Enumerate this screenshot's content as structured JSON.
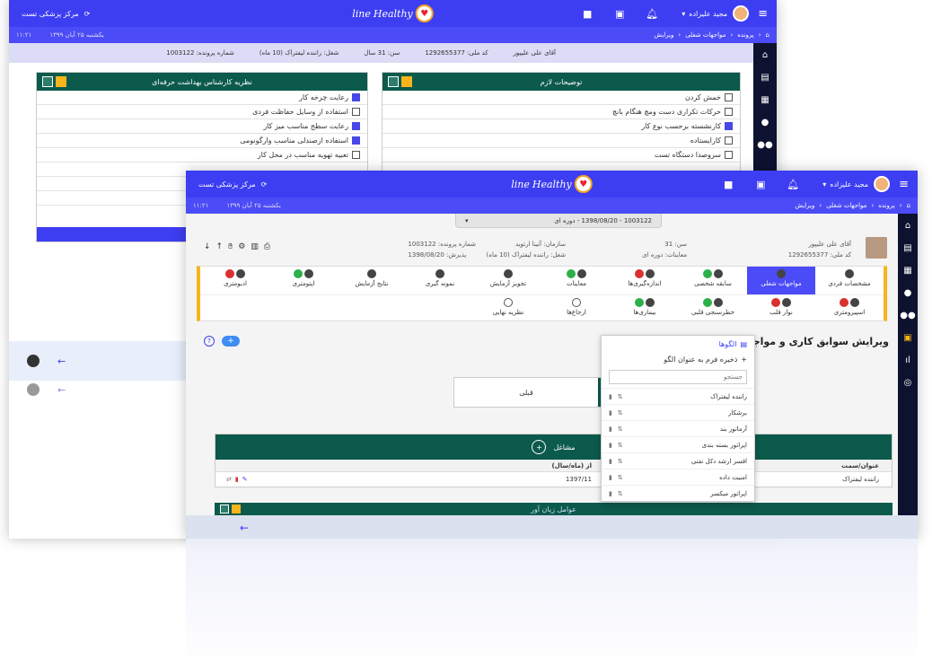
{
  "app": {
    "clinic_name": "مرکز پزشکی تست",
    "user_name": "مجید علیزاده",
    "logo_text": "Healthy",
    "logo_suffix": "line",
    "date_text": "یکشنبه ۲۵ آبان ۱۳۹۹",
    "time_text": "۱۱:۲۱",
    "breadcrumb": [
      "پرونده",
      "مواجهات شغلی",
      "ویرایش"
    ]
  },
  "patient_bar": {
    "name": "آقای علی علیپور",
    "national_code": "کد ملی: 1292655377",
    "age": "سن: 31 سال",
    "job": "شغل: راننده لیفتراک (10 ماه)",
    "file_no": "شماره پرونده: 1003122"
  },
  "back_window": {
    "left_panel_title": "نظریه کارشناس بهداشت حرفه‌ای",
    "left_items": [
      {
        "label": "رعایت چرخه کار",
        "checked": true
      },
      {
        "label": "استفاده از وسایل حفاظت فردی",
        "checked": false
      },
      {
        "label": "رعایت سطح مناسب میز کار",
        "checked": true
      },
      {
        "label": "استفاده ازصندلی مناسب وارگونومی",
        "checked": true
      },
      {
        "label": "تعبیه تهویه مناسب در محل کار",
        "checked": false
      }
    ],
    "right_panel_title": "توضیحات لازم",
    "right_items": [
      {
        "label": "خمش کردن",
        "checked": false
      },
      {
        "label": "حرکات تکراری دست ومچ هنگام بانچ",
        "checked": false
      },
      {
        "label": "کارنشسته برحسب نوع کار",
        "checked": true
      },
      {
        "label": "کارایستاده",
        "checked": false
      },
      {
        "label": "سروصدا دستگاه تست",
        "checked": false
      }
    ]
  },
  "front_window": {
    "period_select": "1003122 - 1398/08/20 - دوره ای",
    "patient": {
      "name": "آقای علی علیپور",
      "national_code": "کد ملی: 1292655377",
      "age": "سن: 31",
      "exam": "معاینات: دوره ای",
      "org": "سازمان: آتینا ارتوید",
      "job": "شغل: راننده لیفتراک (10 ماه)",
      "file_no": "شماره پرونده: 1003122",
      "admission": "پذیرش: 1398/08/20"
    },
    "steps_row1": [
      {
        "label": "مشخصات فردی",
        "status": [
          "k"
        ]
      },
      {
        "label": "مواجهات شغلی",
        "status": [
          "k"
        ],
        "active": true
      },
      {
        "label": "سابقه شخصی",
        "status": [
          "k",
          "g"
        ]
      },
      {
        "label": "اندازه‌گیری‌ها",
        "status": [
          "k",
          "r"
        ]
      },
      {
        "label": "معاینات",
        "status": [
          "k",
          "g"
        ]
      },
      {
        "label": "تجویز آزمایش",
        "status": [
          "k"
        ]
      },
      {
        "label": "نمونه گیری",
        "status": [
          "k"
        ]
      },
      {
        "label": "نتایج آزمایش",
        "status": [
          "k"
        ]
      },
      {
        "label": "اپتومتری",
        "status": [
          "k",
          "g"
        ]
      },
      {
        "label": "ادیومتری",
        "status": [
          "k",
          "r"
        ]
      }
    ],
    "steps_row2": [
      {
        "label": "اسپیرومتری",
        "status": [
          "k",
          "r"
        ]
      },
      {
        "label": "نوار قلب",
        "status": [
          "k",
          "r"
        ]
      },
      {
        "label": "خطرسنجی قلبی",
        "status": [
          "k",
          "g"
        ]
      },
      {
        "label": "بیماری‌ها",
        "status": [
          "k",
          "g"
        ]
      },
      {
        "label": "ارجاع‌ها",
        "status": [
          "o"
        ]
      },
      {
        "label": "نظریه نهایی",
        "status": [
          "o"
        ]
      }
    ],
    "section_title": "ویرایش سوابق کاری و مواجهات شغلی",
    "toggle_label": "قبلی",
    "jobs_title": "مشاغل",
    "table_headers": [
      "عنوان/سمت",
      "از (ماه/سال)"
    ],
    "table_rows": [
      {
        "title": "راننده لیفتراک",
        "from": "1397/11"
      }
    ],
    "next_panel_title": "عوامل زیان آور",
    "templates_menu": {
      "title": "الگوها",
      "save_as": "ذخیره فرم به عنوان الگو",
      "search_placeholder": "جستجو",
      "items": [
        "راننده لیفتراک",
        "برشکار",
        "آرماتور بند",
        "اپراتور بسته بندی",
        "افسر ارشد دکل نفتی",
        "امنیت داده",
        "اپراتور میکسر"
      ]
    }
  },
  "colors": {
    "topbar": "#3d3df2",
    "sidebar": "#0d1230",
    "panel_header": "#0c5a4c",
    "accent_yellow": "#f5b51b"
  }
}
